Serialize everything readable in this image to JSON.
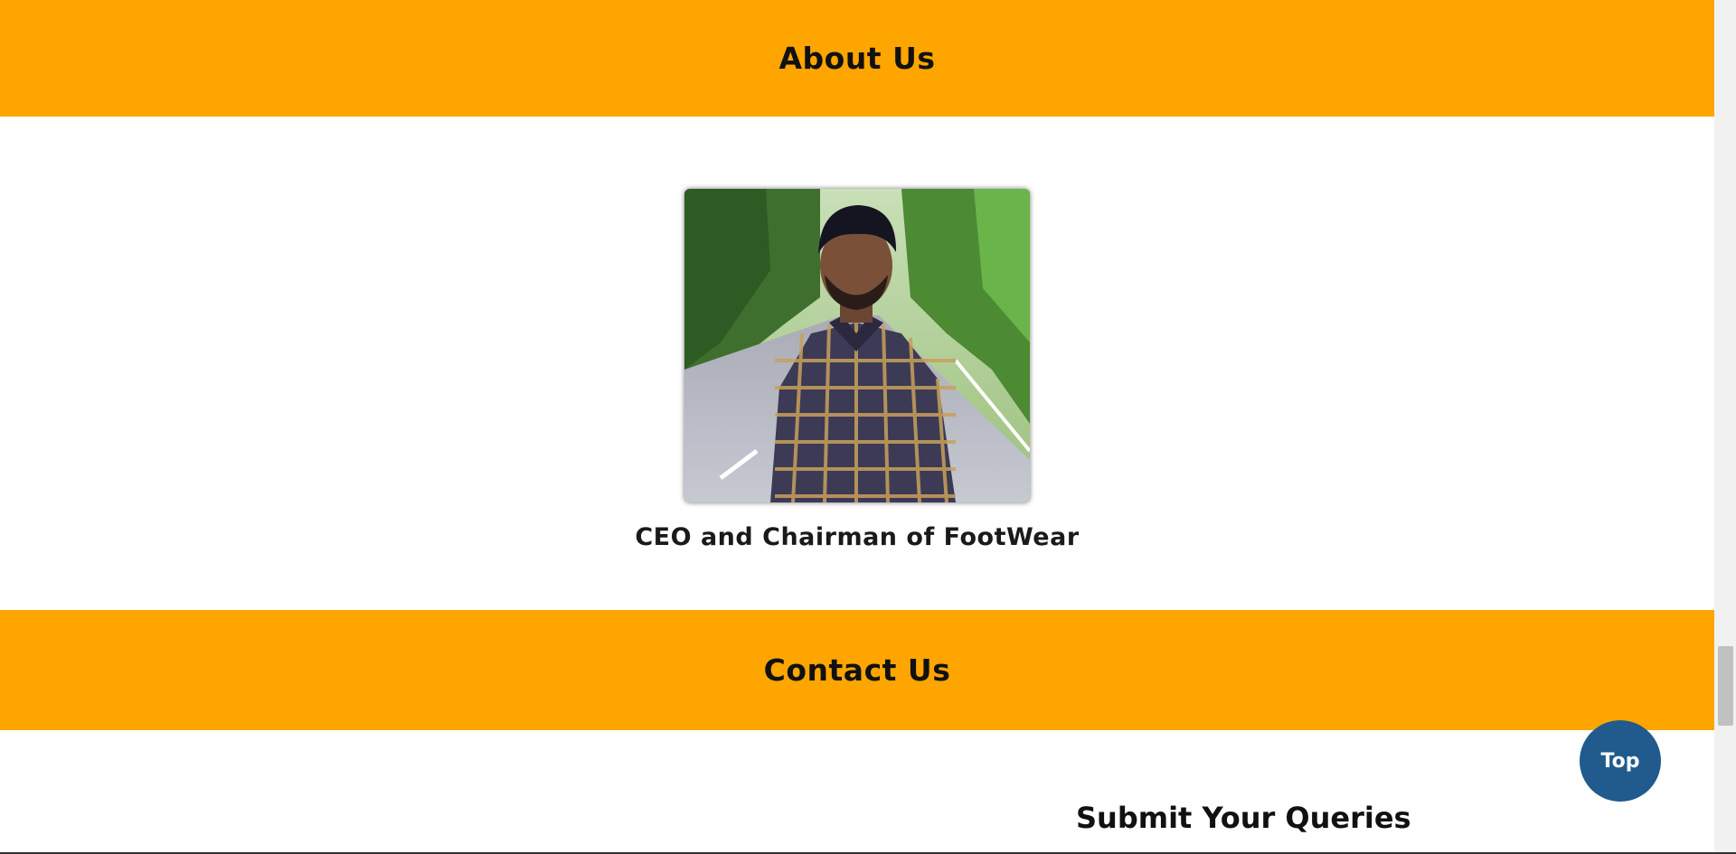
{
  "about": {
    "heading": "About Us",
    "caption": "CEO and Chairman of FootWear"
  },
  "contact": {
    "heading": "Contact Us",
    "form_title": "Submit Your Queries"
  },
  "top_button": {
    "label": "Top"
  },
  "colors": {
    "band": "#fea500",
    "top_button": "#215a8c",
    "text": "#111111"
  },
  "icons": {
    "profile_photo": "person-photo"
  }
}
